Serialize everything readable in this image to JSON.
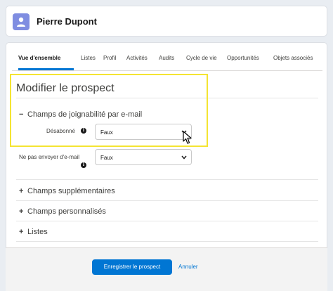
{
  "record": {
    "name": "Pierre Dupont"
  },
  "tabs": [
    {
      "label": "Vue d'ensemble"
    },
    {
      "label": "Listes"
    },
    {
      "label": "Profil"
    },
    {
      "label": "Activités"
    },
    {
      "label": "Audits"
    },
    {
      "label": "Cycle de vie"
    },
    {
      "label": "Opportunités"
    },
    {
      "label": "Objets associés"
    }
  ],
  "form": {
    "title": "Modifier le prospect",
    "section_email": {
      "label": "Champs de joignabilité par e-mail",
      "toggle": "−",
      "fields": [
        {
          "label": "Désabonné",
          "value": "Faux"
        },
        {
          "label": "Ne pas envoyer d'e-mail",
          "value": "Faux"
        }
      ]
    },
    "collapsed_sections": [
      {
        "label": "Champs supplémentaires",
        "toggle": "+"
      },
      {
        "label": "Champs personnalisés",
        "toggle": "+"
      },
      {
        "label": "Listes",
        "toggle": "+"
      }
    ]
  },
  "footer": {
    "save_label": "Enregistrer le prospect",
    "cancel_label": "Annuler"
  },
  "colors": {
    "brand": "#0176d3",
    "highlight": "#f4e432",
    "avatar": "#7f8de1"
  },
  "icons": {
    "avatar": "person-icon",
    "info": "info-icon",
    "dropdown": "chevron-down-icon",
    "cursor": "mouse-pointer-icon"
  }
}
